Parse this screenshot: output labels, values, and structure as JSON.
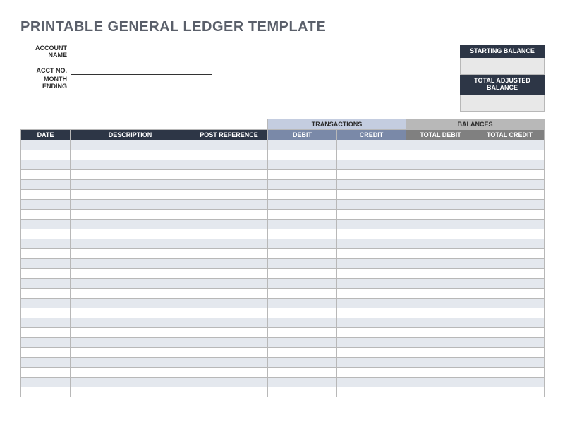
{
  "title": "PRINTABLE GENERAL LEDGER TEMPLATE",
  "info": {
    "account_name_label": "ACCOUNT NAME",
    "account_name_value": "",
    "acct_no_label": "ACCT NO.",
    "acct_no_value": "",
    "month_ending_label": "MONTH ENDING",
    "month_ending_value": ""
  },
  "balance_box": {
    "starting_label": "STARTING BALANCE",
    "starting_value": "",
    "adjusted_label": "TOTAL ADJUSTED BALANCE",
    "adjusted_value": ""
  },
  "group_headers": {
    "transactions": "TRANSACTIONS",
    "balances": "BALANCES"
  },
  "columns": {
    "date": "DATE",
    "description": "DESCRIPTION",
    "post_reference": "POST REFERENCE",
    "debit": "DEBIT",
    "credit": "CREDIT",
    "total_debit": "TOTAL DEBIT",
    "total_credit": "TOTAL CREDIT"
  },
  "rows": [
    {
      "date": "",
      "description": "",
      "post_reference": "",
      "debit": "",
      "credit": "",
      "total_debit": "",
      "total_credit": ""
    },
    {
      "date": "",
      "description": "",
      "post_reference": "",
      "debit": "",
      "credit": "",
      "total_debit": "",
      "total_credit": ""
    },
    {
      "date": "",
      "description": "",
      "post_reference": "",
      "debit": "",
      "credit": "",
      "total_debit": "",
      "total_credit": ""
    },
    {
      "date": "",
      "description": "",
      "post_reference": "",
      "debit": "",
      "credit": "",
      "total_debit": "",
      "total_credit": ""
    },
    {
      "date": "",
      "description": "",
      "post_reference": "",
      "debit": "",
      "credit": "",
      "total_debit": "",
      "total_credit": ""
    },
    {
      "date": "",
      "description": "",
      "post_reference": "",
      "debit": "",
      "credit": "",
      "total_debit": "",
      "total_credit": ""
    },
    {
      "date": "",
      "description": "",
      "post_reference": "",
      "debit": "",
      "credit": "",
      "total_debit": "",
      "total_credit": ""
    },
    {
      "date": "",
      "description": "",
      "post_reference": "",
      "debit": "",
      "credit": "",
      "total_debit": "",
      "total_credit": ""
    },
    {
      "date": "",
      "description": "",
      "post_reference": "",
      "debit": "",
      "credit": "",
      "total_debit": "",
      "total_credit": ""
    },
    {
      "date": "",
      "description": "",
      "post_reference": "",
      "debit": "",
      "credit": "",
      "total_debit": "",
      "total_credit": ""
    },
    {
      "date": "",
      "description": "",
      "post_reference": "",
      "debit": "",
      "credit": "",
      "total_debit": "",
      "total_credit": ""
    },
    {
      "date": "",
      "description": "",
      "post_reference": "",
      "debit": "",
      "credit": "",
      "total_debit": "",
      "total_credit": ""
    },
    {
      "date": "",
      "description": "",
      "post_reference": "",
      "debit": "",
      "credit": "",
      "total_debit": "",
      "total_credit": ""
    },
    {
      "date": "",
      "description": "",
      "post_reference": "",
      "debit": "",
      "credit": "",
      "total_debit": "",
      "total_credit": ""
    },
    {
      "date": "",
      "description": "",
      "post_reference": "",
      "debit": "",
      "credit": "",
      "total_debit": "",
      "total_credit": ""
    },
    {
      "date": "",
      "description": "",
      "post_reference": "",
      "debit": "",
      "credit": "",
      "total_debit": "",
      "total_credit": ""
    },
    {
      "date": "",
      "description": "",
      "post_reference": "",
      "debit": "",
      "credit": "",
      "total_debit": "",
      "total_credit": ""
    },
    {
      "date": "",
      "description": "",
      "post_reference": "",
      "debit": "",
      "credit": "",
      "total_debit": "",
      "total_credit": ""
    },
    {
      "date": "",
      "description": "",
      "post_reference": "",
      "debit": "",
      "credit": "",
      "total_debit": "",
      "total_credit": ""
    },
    {
      "date": "",
      "description": "",
      "post_reference": "",
      "debit": "",
      "credit": "",
      "total_debit": "",
      "total_credit": ""
    },
    {
      "date": "",
      "description": "",
      "post_reference": "",
      "debit": "",
      "credit": "",
      "total_debit": "",
      "total_credit": ""
    },
    {
      "date": "",
      "description": "",
      "post_reference": "",
      "debit": "",
      "credit": "",
      "total_debit": "",
      "total_credit": ""
    },
    {
      "date": "",
      "description": "",
      "post_reference": "",
      "debit": "",
      "credit": "",
      "total_debit": "",
      "total_credit": ""
    },
    {
      "date": "",
      "description": "",
      "post_reference": "",
      "debit": "",
      "credit": "",
      "total_debit": "",
      "total_credit": ""
    },
    {
      "date": "",
      "description": "",
      "post_reference": "",
      "debit": "",
      "credit": "",
      "total_debit": "",
      "total_credit": ""
    },
    {
      "date": "",
      "description": "",
      "post_reference": "",
      "debit": "",
      "credit": "",
      "total_debit": "",
      "total_credit": ""
    }
  ]
}
